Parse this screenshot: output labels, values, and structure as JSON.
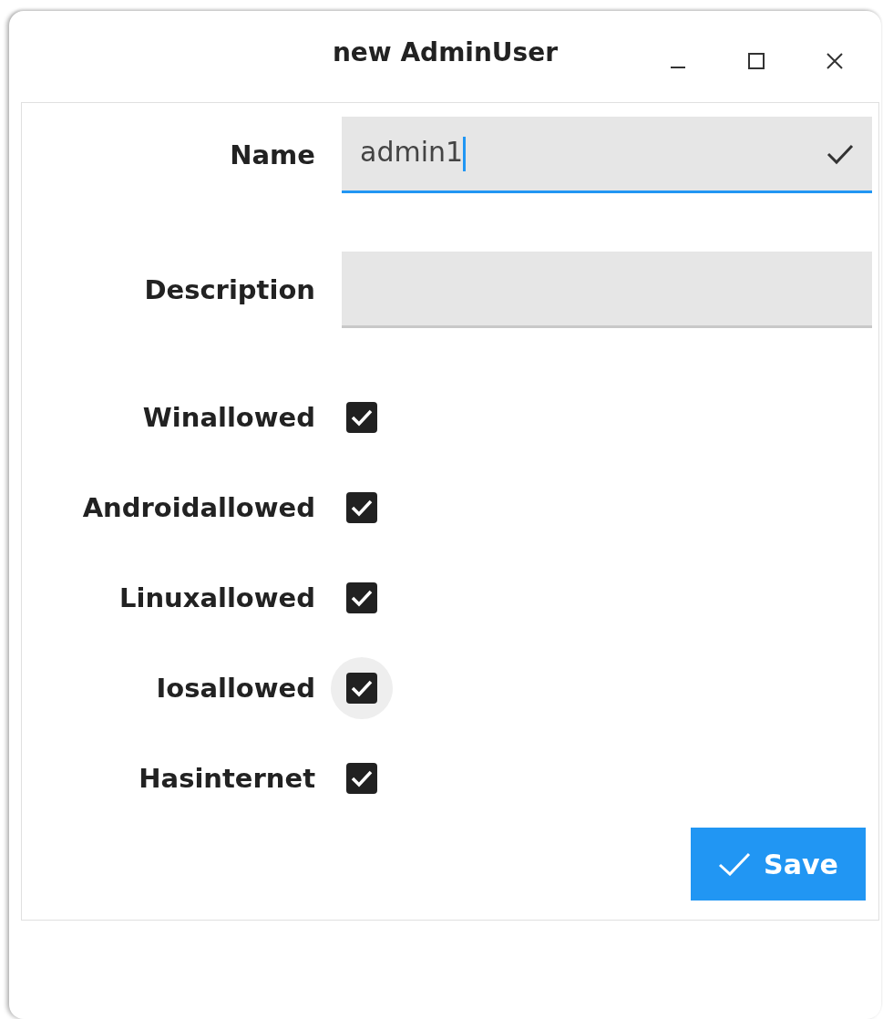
{
  "window": {
    "title": "new AdminUser"
  },
  "fields": [
    {
      "label": "Name",
      "value": "admin1",
      "focused": true,
      "valid": true
    },
    {
      "label": "Description",
      "focused": false,
      "valid": false
    }
  ],
  "checkboxes": [
    {
      "label": "Winallowed",
      "checked": true,
      "hovered": false
    },
    {
      "label": "Androidallowed",
      "checked": true,
      "hovered": false
    },
    {
      "label": "Linuxallowed",
      "checked": true,
      "hovered": false
    },
    {
      "label": "Iosallowed",
      "checked": true,
      "hovered": true
    },
    {
      "label": "Hasinternet",
      "checked": true,
      "hovered": false
    }
  ],
  "save_button": {
    "label": "Save"
  }
}
